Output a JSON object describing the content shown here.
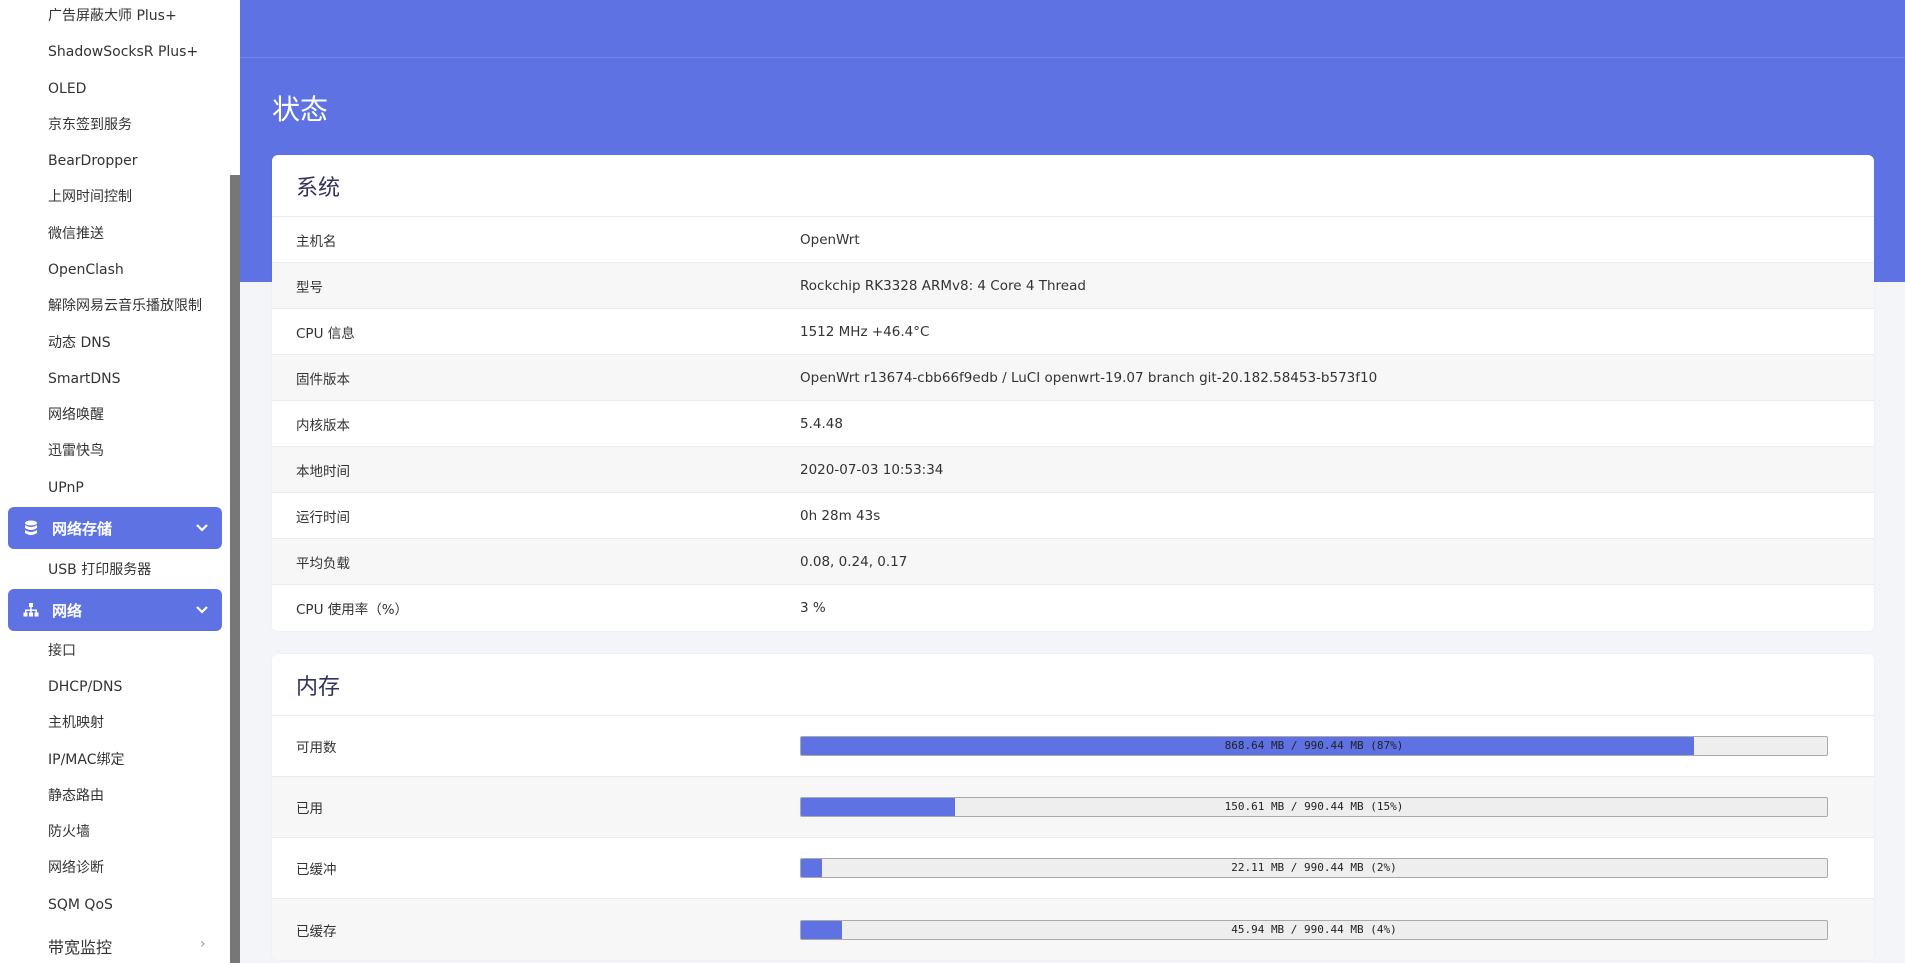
{
  "sidebar": {
    "items_top": [
      "广告屏蔽大师 Plus+",
      "ShadowSocksR Plus+",
      "OLED",
      "京东签到服务",
      "BearDropper",
      "上网时间控制",
      "微信推送",
      "OpenClash",
      "解除网易云音乐播放限制",
      "动态 DNS",
      "SmartDNS",
      "网络唤醒",
      "迅雷快鸟",
      "UPnP"
    ],
    "group_storage": {
      "label": "网络存储",
      "icon": "database-icon"
    },
    "storage_items": [
      "USB 打印服务器"
    ],
    "group_network": {
      "label": "网络",
      "icon": "sitemap-icon"
    },
    "network_items": [
      "接口",
      "DHCP/DNS",
      "主机映射",
      "IP/MAC绑定",
      "静态路由",
      "防火墙",
      "网络诊断",
      "SQM QoS"
    ],
    "last_item": "带宽监控"
  },
  "page": {
    "title": "状态"
  },
  "system": {
    "title": "系统",
    "rows": [
      {
        "key": "主机名",
        "value": "OpenWrt"
      },
      {
        "key": "型号",
        "value": "Rockchip RK3328 ARMv8: 4 Core 4 Thread"
      },
      {
        "key": "CPU 信息",
        "value": "1512 MHz +46.4°C"
      },
      {
        "key": "固件版本",
        "value": "OpenWrt r13674-cbb66f9edb / LuCI openwrt-19.07 branch git-20.182.58453-b573f10"
      },
      {
        "key": "内核版本",
        "value": "5.4.48"
      },
      {
        "key": "本地时间",
        "value": "2020-07-03 10:53:34"
      },
      {
        "key": "运行时间",
        "value": "0h 28m 43s"
      },
      {
        "key": "平均负载",
        "value": "0.08, 0.24, 0.17"
      },
      {
        "key": "CPU 使用率（%）",
        "value": "3 %"
      }
    ]
  },
  "memory": {
    "title": "内存",
    "rows": [
      {
        "key": "可用数",
        "text": "868.64 MB / 990.44 MB (87%)",
        "percent": 87
      },
      {
        "key": "已用",
        "text": "150.61 MB / 990.44 MB (15%)",
        "percent": 15
      },
      {
        "key": "已缓冲",
        "text": "22.11 MB / 990.44 MB (2%)",
        "percent": 2
      },
      {
        "key": "已缓存",
        "text": "45.94 MB / 990.44 MB (4%)",
        "percent": 4
      }
    ]
  },
  "colors": {
    "accent": "#5e72e4"
  }
}
